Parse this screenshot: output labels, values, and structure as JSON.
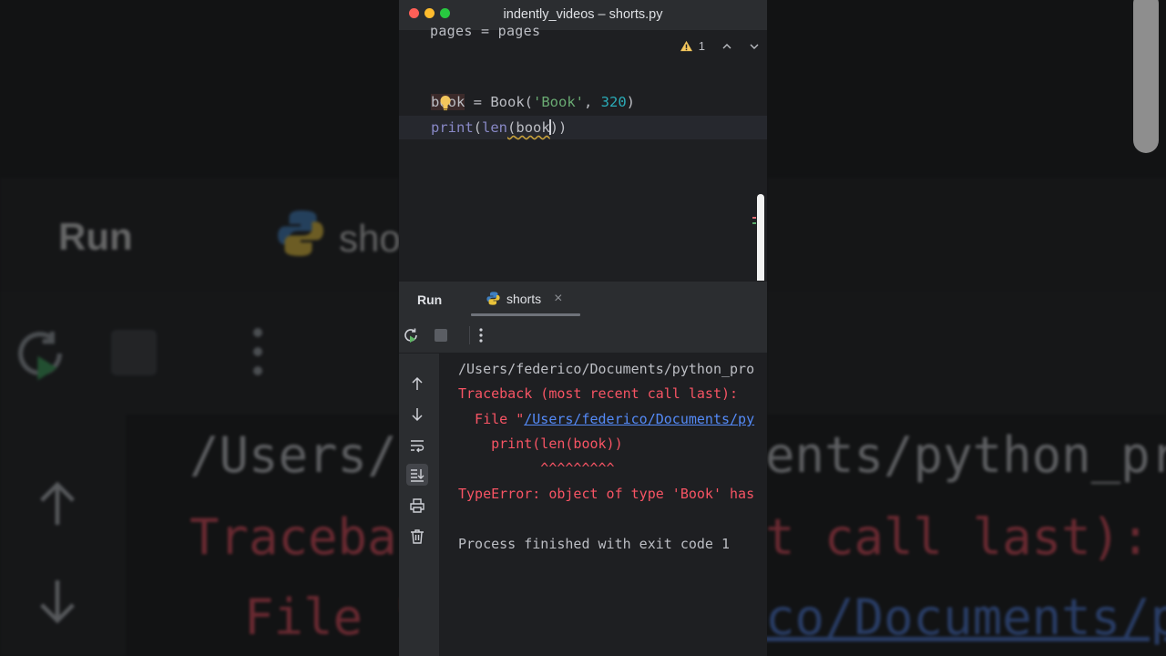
{
  "window": {
    "title": "indently_videos – shorts.py"
  },
  "editor": {
    "cut_line": "       pages = pages",
    "inspection_count": "1",
    "line1": {
      "var": "book",
      "eq": " = ",
      "cls": "Book",
      "open": "(",
      "str": "'Book'",
      "sep": ", ",
      "num": "320",
      "close": ")"
    },
    "line2": {
      "fn": "print",
      "p1": "(",
      "builtin": "len",
      "p2": "(",
      "arg": "book",
      "close": "))"
    }
  },
  "run": {
    "label": "Run",
    "tab_label": "shorts",
    "console": {
      "path_line": "/Users/federico/Documents/python_pro",
      "traceback": "Traceback (most recent call last):",
      "file_prefix": "  File \"",
      "file_link": "/Users/federico/Documents/py",
      "code_line": "    print(len(book))",
      "carets": "          ^^^^^^^^^",
      "error": "TypeError: object of type 'Book' has",
      "finished": "Process finished with exit code 1"
    }
  },
  "background": {
    "run_label": "Run",
    "tab_label": "sho",
    "path_left": "/Users/fe",
    "path_right": "ents/python_pro",
    "traceback_left": "Traceba",
    "traceback_right": "t call last):",
    "file_left": "File \"",
    "file_right": "co/Documents/py"
  },
  "colors": {
    "accent_green": "#28c840",
    "error_red": "#f75464",
    "link_blue": "#548af7",
    "warning_yellow": "#f2c55c"
  }
}
